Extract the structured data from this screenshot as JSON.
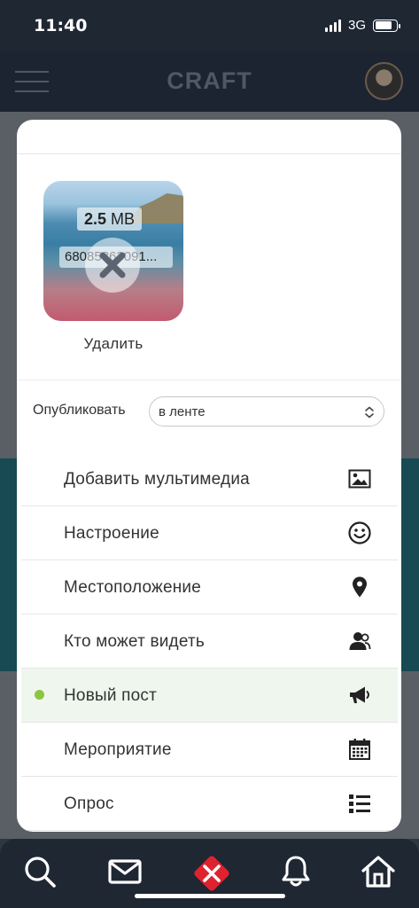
{
  "status_bar": {
    "time": "11:40",
    "network": "3G"
  },
  "header": {
    "logo": "CRAFT"
  },
  "media": {
    "size_value": "2.5",
    "size_unit": "MB",
    "file_name": "68085863091...",
    "remove_label": "Удалить"
  },
  "publish": {
    "label": "Опубликовать",
    "selected": "в ленте"
  },
  "menu": {
    "items": [
      {
        "label": "Добавить мультимедиа",
        "icon": "image-icon"
      },
      {
        "label": "Настроение",
        "icon": "smiley-icon"
      },
      {
        "label": "Местоположение",
        "icon": "location-pin-icon"
      },
      {
        "label": "Кто может видеть",
        "icon": "user-group-icon"
      },
      {
        "label": "Новый пост",
        "icon": "megaphone-icon",
        "active": true
      },
      {
        "label": "Мероприятие",
        "icon": "calendar-icon"
      },
      {
        "label": "Опрос",
        "icon": "list-icon"
      }
    ]
  },
  "tabbar": {
    "tabs": [
      "search-icon",
      "mail-icon",
      "close-icon",
      "bell-icon",
      "home-icon"
    ]
  },
  "colors": {
    "accent_green": "#8cc63f",
    "close_red": "#e0222e",
    "dark_bg": "#1f2733"
  }
}
